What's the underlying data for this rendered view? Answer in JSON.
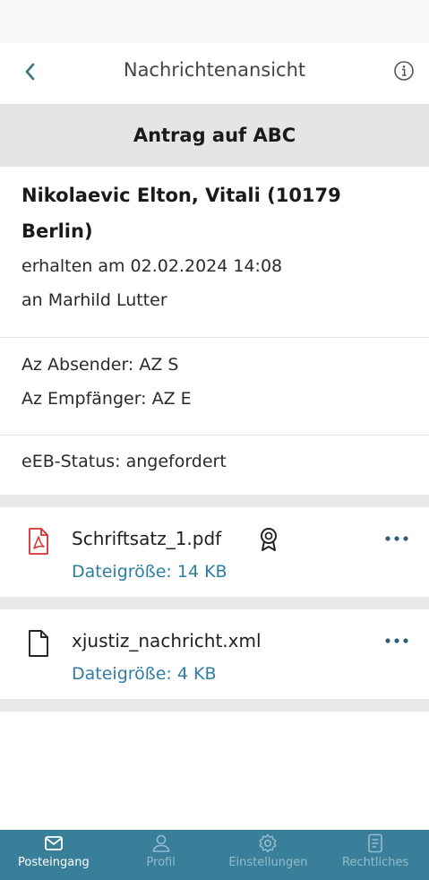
{
  "header": {
    "title": "Nachrichtenansicht",
    "back_icon": "chevron-left-icon",
    "info_icon": "info-icon"
  },
  "message": {
    "subject": "Antrag auf ABC",
    "sender": "Nikolaevic Elton, Vitali (10179 Berlin)",
    "received": "erhalten am 02.02.2024 14:08",
    "recipient": "an Marhild Lutter",
    "az_sender": "Az Absender: AZ S",
    "az_recipient": "Az Empfänger: AZ E",
    "eeb_status": "eEB-Status: angefordert"
  },
  "attachments": [
    {
      "name": "Schriftsatz_1.pdf",
      "size": "Dateigröße: 14 KB",
      "icon": "pdf-file-icon",
      "badge_icon": "certificate-badge-icon"
    },
    {
      "name": "xjustiz_nachricht.xml",
      "size": "Dateigröße: 4 KB",
      "icon": "file-icon"
    }
  ],
  "nav": {
    "items": [
      {
        "label": "Posteingang",
        "icon": "envelope-icon",
        "active": true
      },
      {
        "label": "Profil",
        "icon": "user-icon",
        "active": false
      },
      {
        "label": "Einstellungen",
        "icon": "gear-icon",
        "active": false
      },
      {
        "label": "Rechtliches",
        "icon": "document-icon",
        "active": false
      }
    ]
  },
  "colors": {
    "accent": "#3a7f99",
    "link": "#2f7ea2",
    "pdf_red": "#d9302e",
    "subject_bg": "#e5e5e5"
  }
}
